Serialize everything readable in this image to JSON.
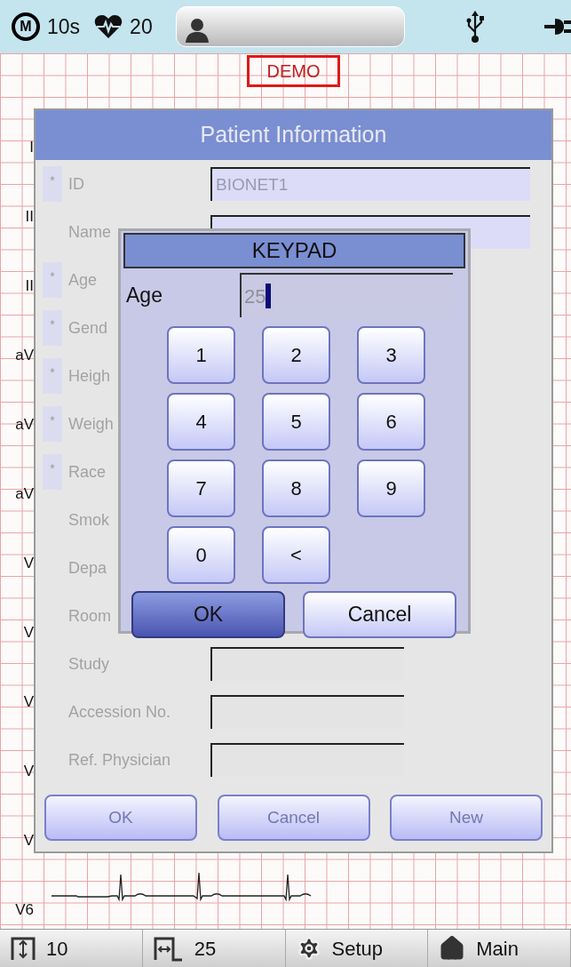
{
  "status_bar": {
    "mode_badge": "M",
    "duration": "10s",
    "heart_rate": "20"
  },
  "demo_label": "DEMO",
  "leads": [
    "I",
    "II",
    "II",
    "aV",
    "aV",
    "aV",
    "V",
    "V",
    "V",
    "V",
    "V",
    "V6"
  ],
  "patient_dialog": {
    "title": "Patient Information",
    "rows": [
      {
        "label": "ID",
        "marker": "*",
        "kind": "highlighted_field",
        "value": "BIONET1"
      },
      {
        "label": "Name",
        "kind": "highlighted_field"
      },
      {
        "label": "Age",
        "marker": "*",
        "kind": "label_only"
      },
      {
        "label": "Gend",
        "marker": "*",
        "kind": "label_only"
      },
      {
        "label": "Heigh",
        "marker": "*",
        "kind": "label_only"
      },
      {
        "label": "Weigh",
        "marker": "*",
        "kind": "label_only"
      },
      {
        "label": "Race",
        "marker": "*",
        "kind": "label_only"
      },
      {
        "label": "Smok",
        "kind": "label_only"
      },
      {
        "label": "Depa",
        "kind": "label_only"
      },
      {
        "label": "Room",
        "kind": "label_only"
      },
      {
        "label": "Study",
        "kind": "plain_field"
      },
      {
        "label": "Accession No.",
        "kind": "plain_field"
      },
      {
        "label": "Ref. Physician",
        "kind": "plain_field"
      }
    ],
    "buttons": [
      {
        "label": "OK",
        "disabled": true
      },
      {
        "label": "Cancel",
        "disabled": true
      },
      {
        "label": "New",
        "disabled": true
      }
    ]
  },
  "keypad": {
    "title": "KEYPAD",
    "field_label": "Age",
    "value": "25",
    "keys": [
      "1",
      "2",
      "3",
      "4",
      "5",
      "6",
      "7",
      "8",
      "9",
      "0",
      "<"
    ],
    "actions": [
      {
        "label": "OK",
        "selected": true
      },
      {
        "label": "Cancel",
        "selected": false
      }
    ]
  },
  "bottom_bar": [
    {
      "label": "10"
    },
    {
      "label": "25"
    },
    {
      "label": "Setup"
    },
    {
      "label": "Main"
    }
  ]
}
